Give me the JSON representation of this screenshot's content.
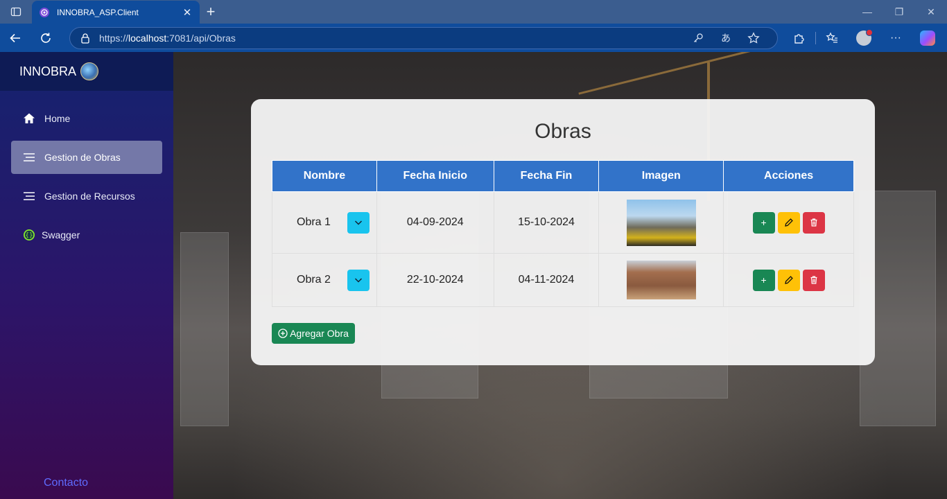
{
  "browser": {
    "tab_title": "INNOBRA_ASP.Client",
    "url_prefix": "https://",
    "url_host": "localhost",
    "url_rest": ":7081/api/Obras",
    "translate_glyph": "あ"
  },
  "sidebar": {
    "brand": "INNOBRA",
    "items": [
      {
        "label": "Home",
        "icon": "home-icon"
      },
      {
        "label": "Gestion de Obras",
        "icon": "list-icon",
        "active": true
      },
      {
        "label": "Gestion de Recursos",
        "icon": "list-icon"
      },
      {
        "label": "Swagger",
        "icon": "swagger-icon"
      }
    ],
    "contact": "Contacto"
  },
  "main": {
    "title": "Obras",
    "columns": [
      "Nombre",
      "Fecha Inicio",
      "Fecha Fin",
      "Imagen",
      "Acciones"
    ],
    "rows": [
      {
        "nombre": "Obra 1",
        "fecha_inicio": "04-09-2024",
        "fecha_fin": "15-10-2024"
      },
      {
        "nombre": "Obra 2",
        "fecha_inicio": "22-10-2024",
        "fecha_fin": "04-11-2024"
      }
    ],
    "add_button": "Agregar Obra"
  },
  "colors": {
    "header_blue": "#3273c9",
    "success": "#198754",
    "warning": "#ffc107",
    "danger": "#dc3545",
    "info": "#19c4ee"
  }
}
